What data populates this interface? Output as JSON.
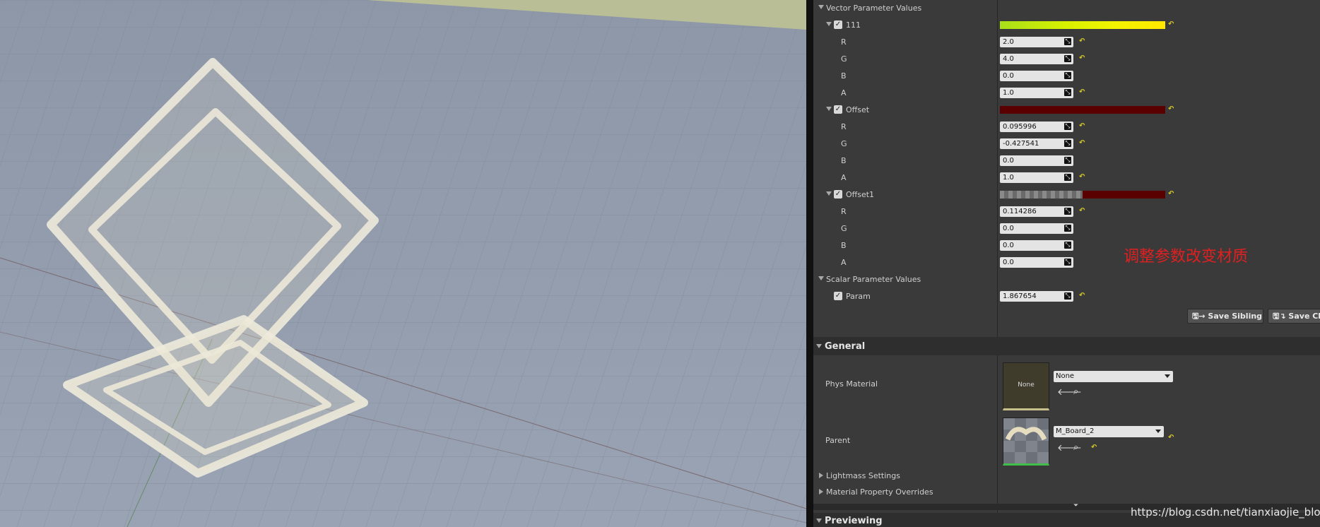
{
  "vector_section": {
    "label": "Vector Parameter Values"
  },
  "vectors": [
    {
      "name": "111",
      "channels": [
        {
          "ch": "R",
          "value": "2.0",
          "reset": true
        },
        {
          "ch": "G",
          "value": "4.0",
          "reset": true
        },
        {
          "ch": "B",
          "value": "0.0",
          "reset": false
        },
        {
          "ch": "A",
          "value": "1.0",
          "reset": true
        }
      ]
    },
    {
      "name": "Offset",
      "channels": [
        {
          "ch": "R",
          "value": "0.095996",
          "reset": true
        },
        {
          "ch": "G",
          "value": "-0.427541",
          "reset": true
        },
        {
          "ch": "B",
          "value": "0.0",
          "reset": false
        },
        {
          "ch": "A",
          "value": "1.0",
          "reset": true
        }
      ]
    },
    {
      "name": "Offset1",
      "channels": [
        {
          "ch": "R",
          "value": "0.114286",
          "reset": true
        },
        {
          "ch": "G",
          "value": "0.0",
          "reset": false
        },
        {
          "ch": "B",
          "value": "0.0",
          "reset": false
        },
        {
          "ch": "A",
          "value": "0.0",
          "reset": false
        }
      ]
    }
  ],
  "scalar_section": {
    "label": "Scalar Parameter Values"
  },
  "scalar": {
    "name": "Param",
    "value": "1.867654"
  },
  "buttons": {
    "save_sibling": "Save Sibling",
    "save_child": "Save Ch"
  },
  "general": {
    "label": "General",
    "phys_material": {
      "label": "Phys Material",
      "thumb_text": "None",
      "value": "None"
    },
    "parent": {
      "label": "Parent",
      "value": "M_Board_2"
    }
  },
  "collapsed_sections": [
    "Lightmass Settings",
    "Material Property Overrides"
  ],
  "previewing": {
    "label": "Previewing"
  },
  "annotation": "调整参数改变材质",
  "watermark": "https://blog.csdn.net/tianxiaojie_blog",
  "colors": {
    "accent_reset": "#d6c928",
    "offset_color": "#5a0000",
    "annotation": "#e02020"
  },
  "icons": [
    "expand-triangle-icon",
    "checkbox-checked-icon",
    "drag-arrows-icon",
    "reset-to-default-icon",
    "save-icon",
    "back-arrow-icon",
    "browse-search-icon",
    "dropdown-arrow-icon",
    "collapse-arrow-icon"
  ]
}
